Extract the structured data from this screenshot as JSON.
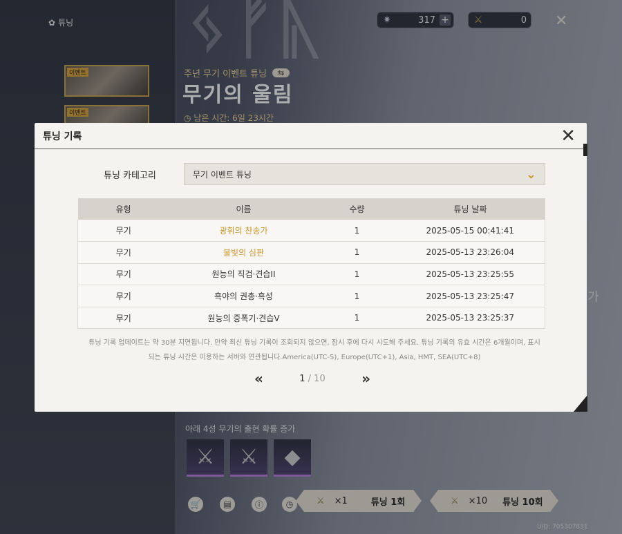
{
  "topbar": {
    "section_label": "튜닝",
    "currency1_value": "317",
    "currency2_value": "0",
    "plus_label": "+"
  },
  "banners": [
    {
      "tag": "이벤트"
    },
    {
      "tag": "이벤트"
    }
  ],
  "event": {
    "subtitle": "주년 무기 이벤트 튜닝",
    "title": "무기의 울림",
    "remaining": "남은 시간: 6일 23시간"
  },
  "rate_up": {
    "label": "아래 4성 무기의 출현 확률 증가"
  },
  "pull": {
    "one_count": "×1",
    "one_label": "튜닝 1회",
    "ten_count": "×10",
    "ten_label": "튜닝 10회"
  },
  "uid": "UID: 705307831",
  "modal": {
    "title": "튜닝 기록",
    "category_label": "튜닝 카테고리",
    "category_value": "무기 이벤트 튜닝",
    "columns": [
      "유형",
      "이름",
      "수량",
      "튜닝 날짜"
    ],
    "rows": [
      {
        "type": "무기",
        "name": "광휘의 찬송가",
        "qty": "1",
        "date": "2025-05-15 00:41:41",
        "highlight": true
      },
      {
        "type": "무기",
        "name": "불빛의 심판",
        "qty": "1",
        "date": "2025-05-13 23:26:04",
        "highlight": true
      },
      {
        "type": "무기",
        "name": "원능의 직검·견습II",
        "qty": "1",
        "date": "2025-05-13 23:25:55",
        "highlight": false
      },
      {
        "type": "무기",
        "name": "흑야의 권총·흑성",
        "qty": "1",
        "date": "2025-05-13 23:25:47",
        "highlight": false
      },
      {
        "type": "무기",
        "name": "원능의 증폭기·견습V",
        "qty": "1",
        "date": "2025-05-13 23:25:37",
        "highlight": false
      }
    ],
    "note_line1": "튜닝 기록 업데이트는 약 30분 지연됩니다. 만약 최신 튜닝 기록이 조회되지 않으면, 잠시 후에 다시 시도해 주세요. 튜닝 기록의 유효 시간은 6개월이며, 표시",
    "note_line2": "되는 튜닝 시간은 이용하는 서버와 연관됩니다.America(UTC-5), Europe(UTC+1), Asia, HMT, SEA(UTC+8)",
    "page_current": "1",
    "page_total": "/ 10"
  },
  "colors": {
    "accent_gold": "#c9962e",
    "modal_bg": "#f4f3f0"
  }
}
